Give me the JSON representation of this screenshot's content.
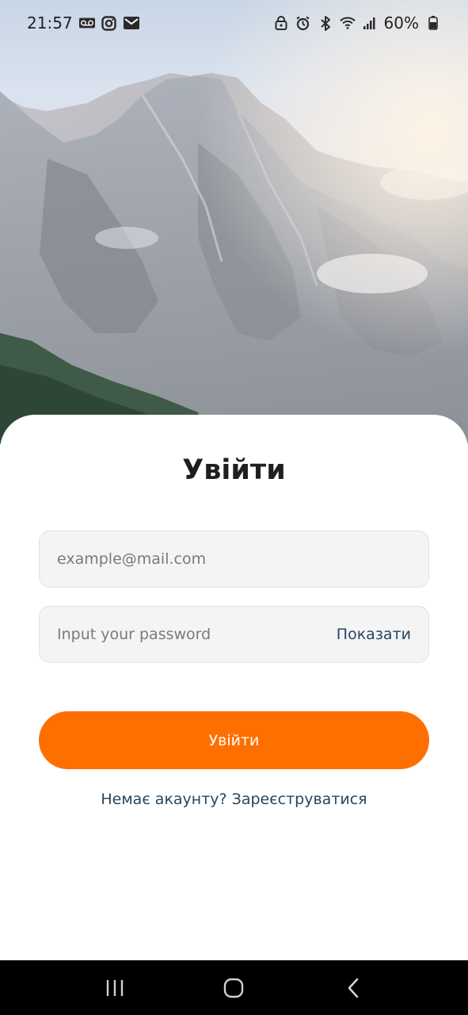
{
  "status_bar": {
    "time": "21:57",
    "left_icons": [
      "voicemail-icon",
      "instagram-icon",
      "mail-icon"
    ],
    "right_icons": [
      "lock-icon",
      "alarm-icon",
      "bluetooth-icon",
      "wifi-icon",
      "signal-icon",
      "battery-icon"
    ],
    "battery_percent": "60%"
  },
  "hero": {
    "image": "mountain-landscape"
  },
  "login": {
    "title": "Увійти",
    "email_placeholder": "example@mail.com",
    "password_placeholder": "Input your password",
    "show_password_label": "Показати",
    "submit_label": "Увійти",
    "register_prompt": "Немає акаунту? Зареєструватися"
  },
  "colors": {
    "accent": "#ff6f00",
    "link": "#27465e",
    "field_bg": "#f4f4f5"
  },
  "nav_bar": {
    "buttons": [
      "recent-apps-icon",
      "home-icon",
      "back-icon"
    ]
  }
}
